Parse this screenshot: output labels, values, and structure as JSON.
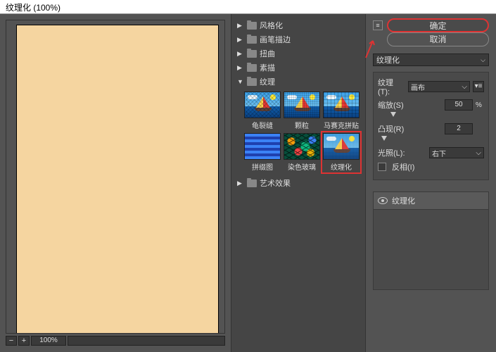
{
  "title": "纹理化 (100%)",
  "zoom": "100%",
  "buttons": {
    "ok": "确定",
    "cancel": "取消"
  },
  "filter_select": "纹理化",
  "categories": [
    {
      "label": "风格化",
      "open": false
    },
    {
      "label": "画笔描边",
      "open": false
    },
    {
      "label": "扭曲",
      "open": false
    },
    {
      "label": "素描",
      "open": false
    },
    {
      "label": "纹理",
      "open": true
    },
    {
      "label": "艺术效果",
      "open": false
    }
  ],
  "texture_thumbs": [
    {
      "label": "龟裂缝"
    },
    {
      "label": "颗粒"
    },
    {
      "label": "马赛克拼贴"
    },
    {
      "label": "拼缀图"
    },
    {
      "label": "染色玻璃"
    },
    {
      "label": "纹理化",
      "selected": true
    }
  ],
  "params": {
    "texture_label": "纹理(T):",
    "texture_value": "画布",
    "scale_label": "缩放(S)",
    "scale_value": "50",
    "scale_unit": "%",
    "relief_label": "凸现(R)",
    "relief_value": "2",
    "light_label": "光照(L):",
    "light_value": "右下",
    "invert_label": "反相(I)"
  },
  "layer_name": "纹理化"
}
